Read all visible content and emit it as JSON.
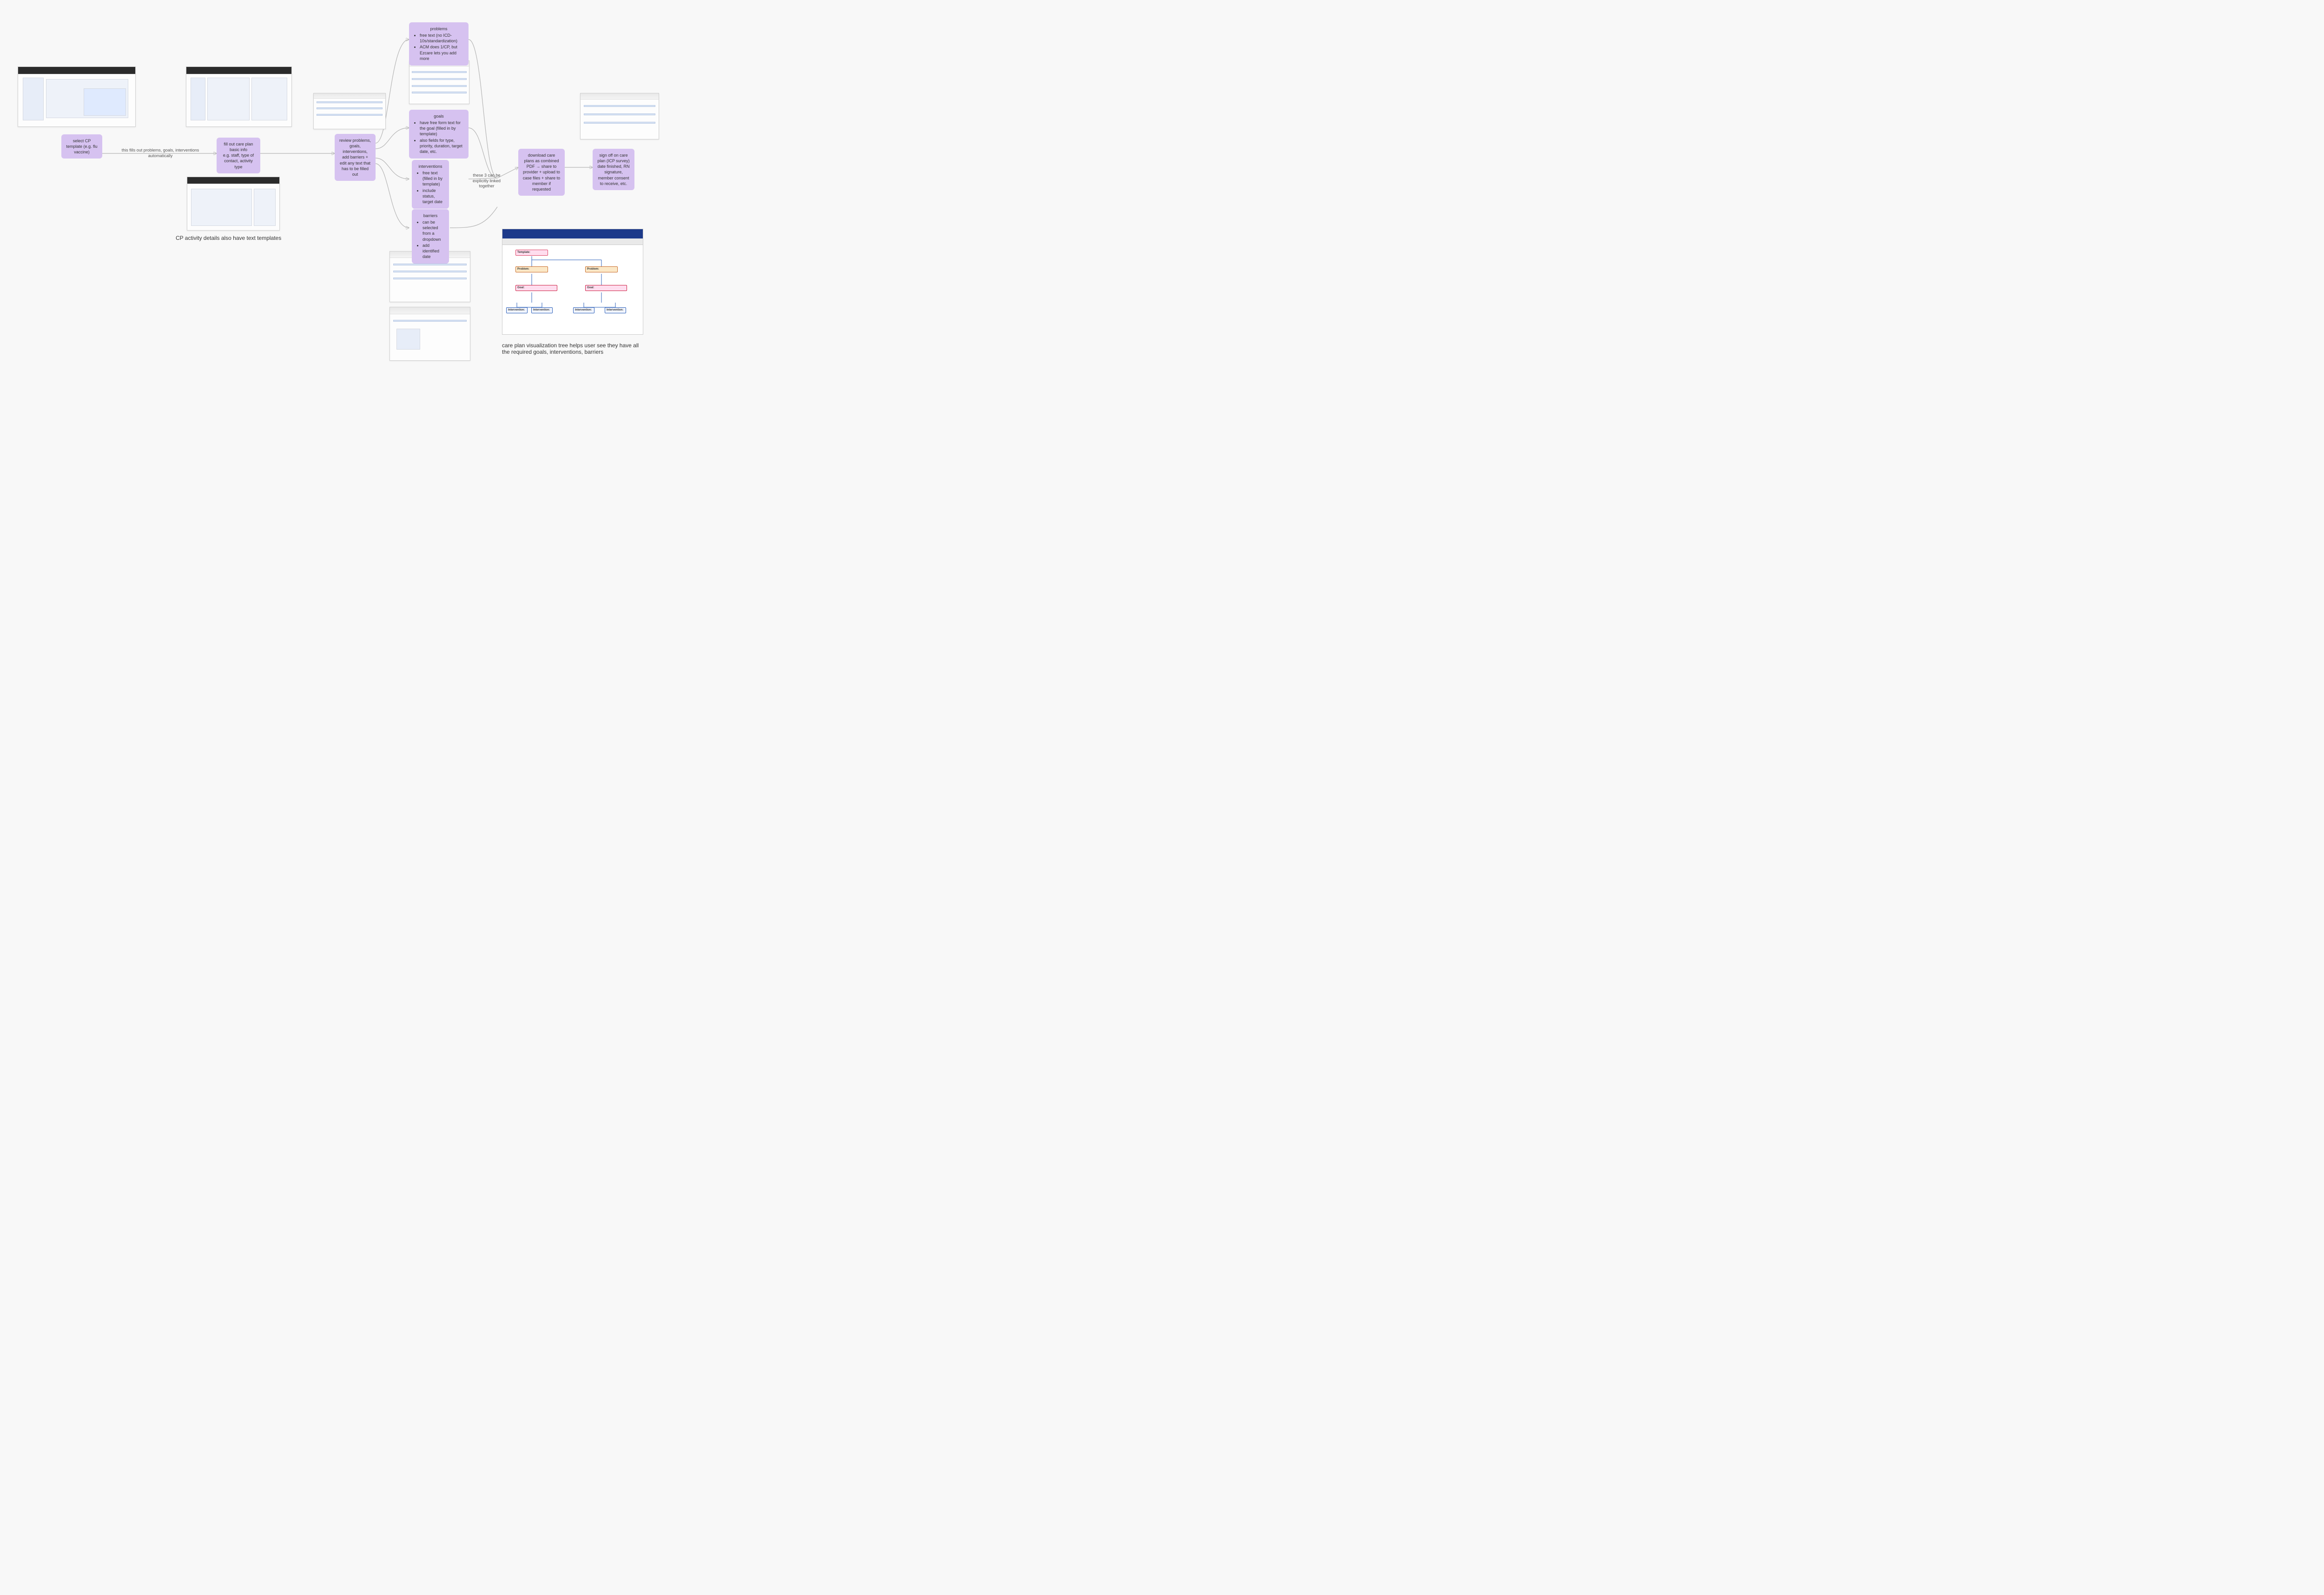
{
  "nodes": {
    "select_cp": "select CP template (e.g. flu vaccine)",
    "fill_basic": "fill out care plan basic info\ne.g. staff, type of contact, activity type",
    "review": "review problems, goals, interventions, add barriers + edit any text that has to be filled out",
    "download": "download care plans as combined PDF → share to provider + upload to case files + share to member if requested",
    "signoff": "sign off on care plan (ICP survey) date finished, RN signature, member consent to receive, etc."
  },
  "detail_nodes": {
    "problems": {
      "title": "problems",
      "items": [
        "free text (no ICD-10s/standardization)",
        "ACM does 1/CP, but Ezcare lets you add more"
      ]
    },
    "goals": {
      "title": "goals",
      "items": [
        "have free form text for the goal (filled in by template)",
        "also fields for type, priority, duration, target date, etc."
      ]
    },
    "interventions": {
      "title": "interventions",
      "items": [
        "free text (filled in by template)",
        "include status, target date"
      ]
    },
    "barriers": {
      "title": "barriers",
      "items": [
        "can be selected from a dropdown",
        "add identified date"
      ]
    }
  },
  "edge_labels": {
    "auto_fill": "this fills out problems, goals, interventions automatically",
    "link3": "these 3 can be explicitly linked together"
  },
  "captions": {
    "templates": "CP activity details also have text templates",
    "tree": "care plan visualization tree helps user see they have all the required goals, interventions, barriers"
  },
  "tree": {
    "template_label": "Template:",
    "problem_label": "Problem:",
    "goal_label": "Goal:",
    "intervention_label": "Intervention:"
  }
}
